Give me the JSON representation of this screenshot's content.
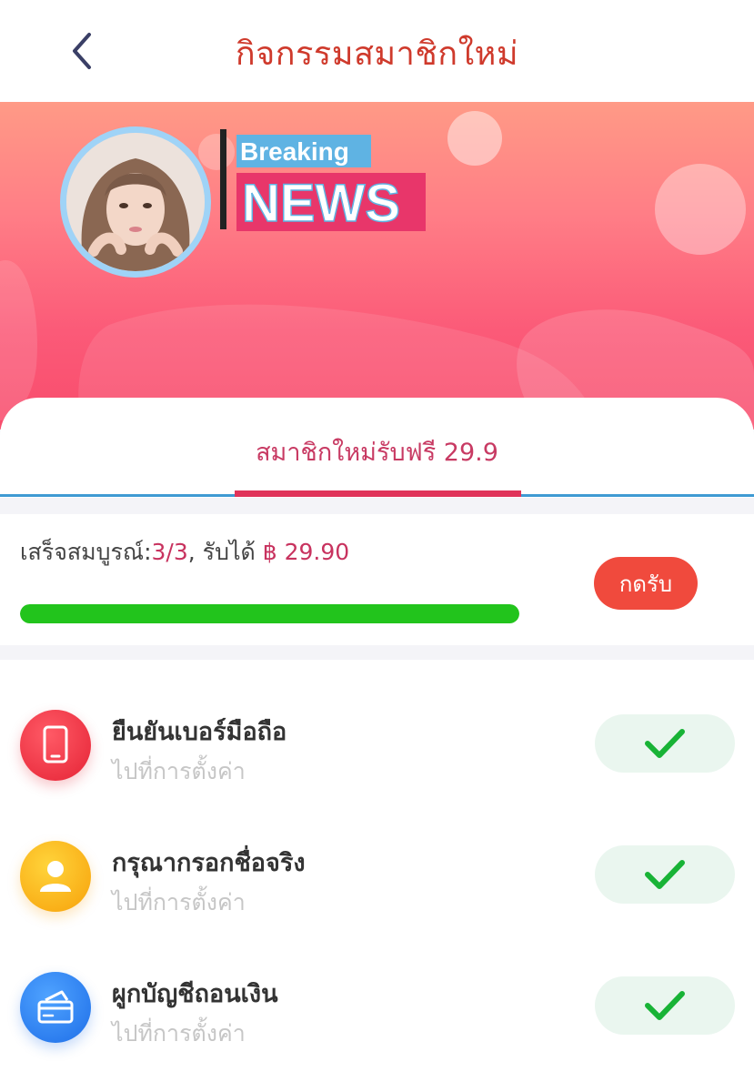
{
  "header": {
    "title": "กิจกรรมสมาชิกใหม่",
    "back_icon": "chevron-left-icon"
  },
  "banner": {
    "logo_top": "Breaking",
    "logo_bottom": "NEWS",
    "colors": {
      "top": "#ff9a86",
      "bottom": "#f84c6c",
      "avatar_ring": "#9fd3f7"
    }
  },
  "tab": {
    "label": "สมาชิกใหม่รับฟรี 29.9",
    "active_color": "#e0335a"
  },
  "progress": {
    "label_prefix": "เสร็จสมบูรณ์:",
    "completed": "3/3",
    "label_middle": ", รับได้ ",
    "reward": "฿ 29.90",
    "fraction": 1.0,
    "claim_button": "กดรับ",
    "bar_color": "#22c41c"
  },
  "tasks": [
    {
      "title": "ยืนยันเบอร์มือถือ",
      "subtitle": "ไปที่การตั้งค่า",
      "icon": "phone-icon",
      "icon_color": "#e52335",
      "done": true
    },
    {
      "title": "กรุณากรอกชื่อจริง",
      "subtitle": "ไปที่การตั้งค่า",
      "icon": "user-icon",
      "icon_color": "#fbb10f",
      "done": true
    },
    {
      "title": "ผูกบัญชีถอนเงิน",
      "subtitle": "ไปที่การตั้งค่า",
      "icon": "card-icon",
      "icon_color": "#2a7cf0",
      "done": true
    }
  ]
}
